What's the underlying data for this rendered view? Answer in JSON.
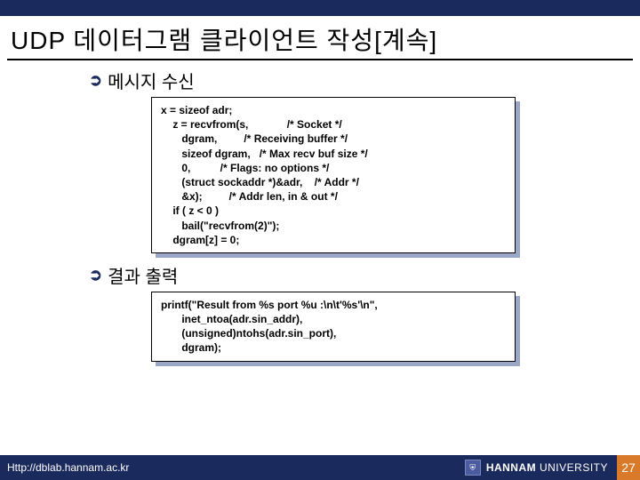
{
  "title": "UDP 데이터그램 클라이언트 작성[계속]",
  "section1": {
    "heading": "메시지 수신",
    "code": "x = sizeof adr;\n    z = recvfrom(s,             /* Socket */\n       dgram,         /* Receiving buffer */\n       sizeof dgram,   /* Max recv buf size */\n       0,          /* Flags: no options */\n       (struct sockaddr *)&adr,    /* Addr */\n       &x);         /* Addr len, in & out */\n    if ( z < 0 )\n       bail(\"recvfrom(2)\");\n    dgram[z] = 0;"
  },
  "section2": {
    "heading": "결과 출력",
    "code": "printf(\"Result from %s port %u :\\n\\t'%s'\\n\",\n       inet_ntoa(adr.sin_addr),\n       (unsigned)ntohs(adr.sin_port),\n       dgram);"
  },
  "footer": {
    "url": "Http://dblab.hannam.ac.kr",
    "uni_bold": "HANNAM",
    "uni_rest": "  UNIVERSITY",
    "page": "27"
  }
}
